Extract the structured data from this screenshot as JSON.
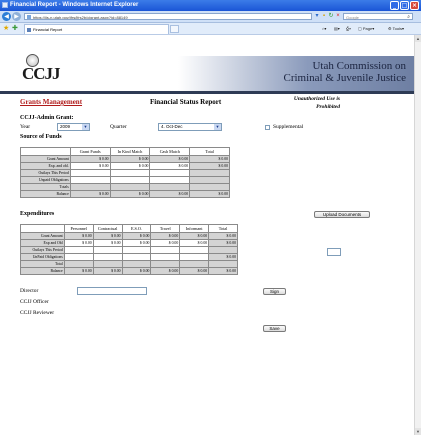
{
  "browser": {
    "title": "Financial Report - Windows Internet Explorer",
    "url": "https://ijs-n.utah.gov/ifrs/ifrs2b/cjgrant.aspx?id=88149",
    "search_placeholder": "Google",
    "tab_label": "Financial Report",
    "page_menu": "Page",
    "tools_menu": "Tools"
  },
  "header": {
    "logo_text": "CCJJ",
    "org_line1": "Utah Commission on",
    "org_line2": "Criminal & Juvenile Justice"
  },
  "page": {
    "grants_link": "Grants Management",
    "title": "Financial Status Report",
    "unauth_line1": "Unauthorized Use is",
    "unauth_line2": "Prohibited",
    "admin_grant": "CCJJ-Admin Grant:",
    "year_label": "Year",
    "year_value": "2009",
    "quarter_label": "Quarter",
    "quarter_value": "4. Oct-Dec",
    "supplemental_label": "Supplemental",
    "source_of_funds": "Source of Funds",
    "expenditures": "Expenditures",
    "upload_button": "Upload Documents",
    "director_label": "Director",
    "officer_label": "CCJJ Officer",
    "reviewer_label": "CCJJ Reviewer",
    "sign_button": "Sign",
    "save_button": "Save"
  },
  "funds_table": {
    "headers": [
      "",
      "Grant Funds",
      "In Kind Match",
      "Cash Match",
      "Total"
    ],
    "rows": [
      {
        "label": "Grant Amount",
        "cells": [
          "$ 0.00",
          "$ 0.00",
          "$ 0.00",
          "$ 0.00"
        ]
      },
      {
        "label": "Exp. and obl.",
        "cells": [
          "$ 0.00",
          "$ 0.00",
          "$ 0.00",
          "$ 0.00"
        ]
      },
      {
        "label": "Outlays This Period",
        "cells": [
          "",
          "",
          "",
          ""
        ]
      },
      {
        "label": "Unpaid Obligations",
        "cells": [
          "",
          "",
          "",
          ""
        ]
      },
      {
        "label": "Totals",
        "cells": [
          "",
          "",
          "",
          ""
        ]
      },
      {
        "label": "Balance",
        "cells": [
          "$ 0.00",
          "$ 0.00",
          "$ 0.00",
          "$ 0.00"
        ]
      }
    ]
  },
  "exp_table": {
    "headers": [
      "",
      "Personnel",
      "Contractual",
      "E.S.O.",
      "Travel",
      "Informant",
      "Total"
    ],
    "rows": [
      {
        "label": "Grant Amount",
        "cells": [
          "$ 0.00",
          "$ 0.00",
          "$ 0.00",
          "$ 0.00",
          "$ 0.00",
          "$ 0.00"
        ]
      },
      {
        "label": "Exp and Obl",
        "cells": [
          "$ 0.00",
          "$ 0.00",
          "$ 0.00",
          "$ 0.00",
          "$ 0.00",
          "$ 0.00"
        ]
      },
      {
        "label": "Outlays This Period",
        "cells": [
          "",
          "",
          "",
          "",
          "",
          ""
        ]
      },
      {
        "label": "UnPaid Obligations",
        "cells": [
          "",
          "",
          "",
          "",
          "",
          "$ 0.00"
        ]
      },
      {
        "label": "Total",
        "cells": [
          "",
          "",
          "",
          "",
          "",
          ""
        ]
      },
      {
        "label": "Balance",
        "cells": [
          "$ 0.00",
          "$ 0.00",
          "$ 0.00",
          "$ 0.00",
          "$ 0.00",
          "$ 0.00"
        ]
      }
    ]
  }
}
